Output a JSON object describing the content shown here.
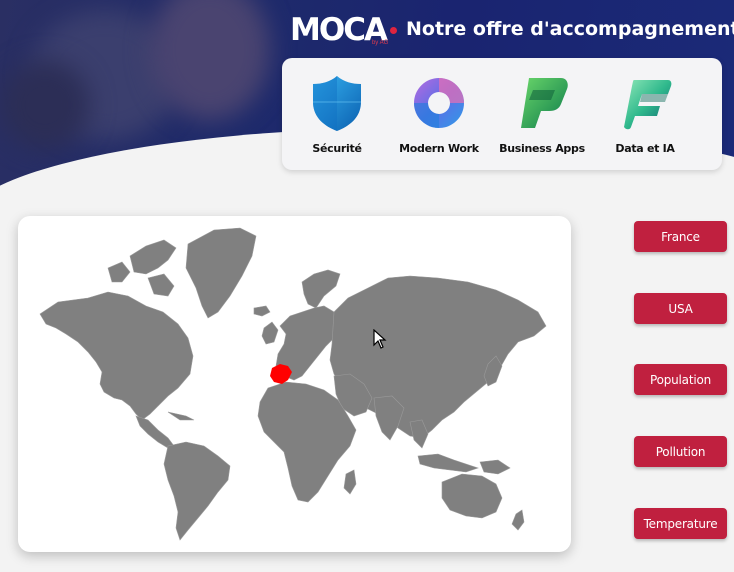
{
  "header": {
    "logo_text": "MOCA",
    "logo_sub": "by AG",
    "title": "Notre offre d'accompagnement",
    "offers": [
      {
        "label": "Sécurité",
        "icon": "shield-icon"
      },
      {
        "label": "Modern Work",
        "icon": "modern-work-icon"
      },
      {
        "label": "Business Apps",
        "icon": "power-apps-icon"
      },
      {
        "label": "Data et IA",
        "icon": "fabric-icon"
      }
    ]
  },
  "map": {
    "highlight_country": "France",
    "highlight_color": "#ff0000",
    "land_color": "#808080"
  },
  "buttons": [
    {
      "label": "France"
    },
    {
      "label": "USA"
    },
    {
      "label": "Population"
    },
    {
      "label": "Pollution"
    },
    {
      "label": "Temperature"
    }
  ],
  "colors": {
    "button": "#c0203f",
    "header": "#1e2a6b"
  }
}
